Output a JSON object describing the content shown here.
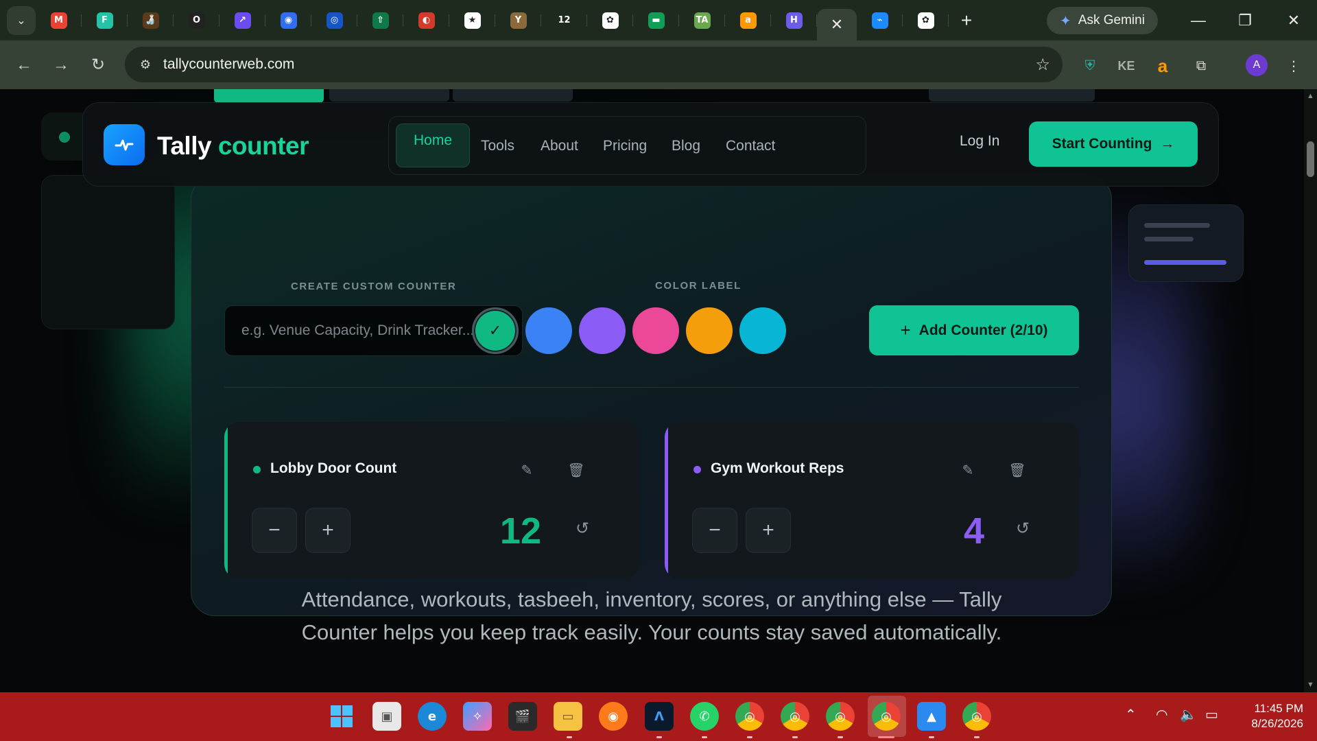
{
  "browser": {
    "tabs": [
      {
        "icon": "gmail-icon",
        "glyph": "M",
        "color": "#ea4335"
      },
      {
        "icon": "f-app-icon",
        "glyph": "F",
        "color": "#22c3a6"
      },
      {
        "icon": "bottle-icon",
        "glyph": "🍶",
        "color": "#5a3a1a"
      },
      {
        "icon": "circle-app-icon",
        "glyph": "O",
        "color": "#222222"
      },
      {
        "icon": "chart-app-icon",
        "glyph": "↗",
        "color": "#6b4cf0"
      },
      {
        "icon": "blue-dot-icon",
        "glyph": "◉",
        "color": "#2f6ef0"
      },
      {
        "icon": "robot-icon",
        "glyph": "◎",
        "color": "#1456c8"
      },
      {
        "icon": "upload-icon",
        "glyph": "⇧",
        "color": "#0e7a4a"
      },
      {
        "icon": "red-swirl-icon",
        "glyph": "◐",
        "color": "#d23a2a"
      },
      {
        "icon": "star-app-icon",
        "glyph": "★",
        "color": "#ffffff"
      },
      {
        "icon": "y-app-icon",
        "glyph": "Y",
        "color": "#8a6a3a"
      },
      {
        "icon": "twelve-icon",
        "glyph": "12",
        "color": "#1f2a1f"
      },
      {
        "icon": "openai-icon",
        "glyph": "✿",
        "color": "#ffffff"
      },
      {
        "icon": "sheet-icon",
        "glyph": "▬",
        "color": "#0f9d58"
      },
      {
        "icon": "ta-icon",
        "glyph": "TA",
        "color": "#6aa84f"
      },
      {
        "icon": "amazon-icon",
        "glyph": "a",
        "color": "#ff9900"
      },
      {
        "icon": "h-app-icon",
        "glyph": "H",
        "color": "#6c5ce7"
      }
    ],
    "active_tab_close": "✕",
    "after_tabs": [
      {
        "icon": "tally-icon",
        "glyph": "⌁",
        "color": "#1a8cff"
      },
      {
        "icon": "openai-icon",
        "glyph": "✿",
        "color": "#ffffff"
      }
    ],
    "new_tab": "+",
    "gemini_label": "Ask Gemini",
    "url": "tallycounterweb.com",
    "profile_initial": "A",
    "ext_ke": "KE"
  },
  "header": {
    "logo_word1": "Tally",
    "logo_word2": "counter",
    "nav": [
      "Home",
      "Tools",
      "About",
      "Pricing",
      "Blog",
      "Contact"
    ],
    "login": "Log In",
    "cta": "Start Counting",
    "cta_arrow": "→"
  },
  "creator": {
    "custom_label": "CREATE CUSTOM COUNTER",
    "color_label": "COLOR LABEL",
    "placeholder": "e.g. Venue Capacity, Drink Tracker...",
    "colors": [
      "#10b981",
      "#3b82f6",
      "#8b5cf6",
      "#ec4899",
      "#f59e0b",
      "#06b6d4"
    ],
    "selected_mark": "✓",
    "add_button": "Add Counter (2/10)"
  },
  "counters": [
    {
      "name": "Lobby Door Count",
      "value": "12",
      "color": "#10b981"
    },
    {
      "name": "Gym Workout Reps",
      "value": "4",
      "color": "#8b5cf6"
    }
  ],
  "tagline": {
    "line1": "Attendance, workouts, tasbeeh, inventory, scores, or anything else — Tally",
    "line2": "Counter helps you keep track easily. Your counts stay saved automatically."
  },
  "taskbar": {
    "time": "11:45 PM",
    "date": "8/26/2026"
  }
}
